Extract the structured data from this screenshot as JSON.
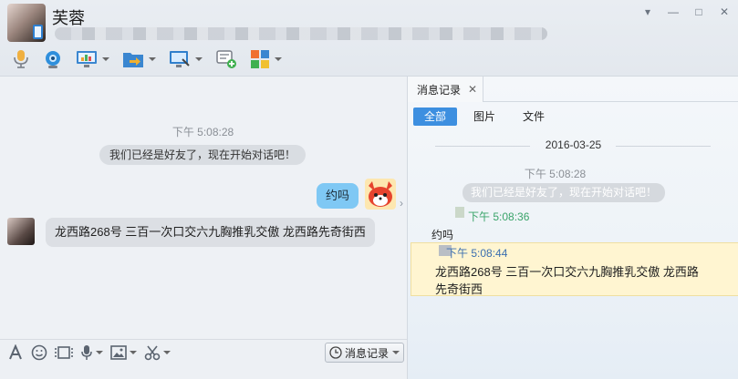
{
  "contact": {
    "name": "芙蓉"
  },
  "window_controls": [
    "▾",
    "—",
    "□",
    "✕"
  ],
  "chat": {
    "timestamp": "下午 5:08:28",
    "system_message": "我们已经是好友了，现在开始对话吧！",
    "my_message": "约吗",
    "peer_message": "龙西路268号 三百一次口交六九胸推乳交傲  龙西路先奇街西"
  },
  "input_bar": {
    "history_button_label": "消息记录"
  },
  "history": {
    "tab_label": "消息记录",
    "filters": [
      "全部",
      "图片",
      "文件"
    ],
    "date": "2016-03-25",
    "entries": {
      "system_time": "下午 5:08:28",
      "system_message": "我们已经是好友了，现在开始对话吧！",
      "my_time": "下午 5:08:36",
      "my_message": "约吗",
      "peer_time": "下午 5:08:44",
      "peer_message": "龙西路268号 三百一次口交六九胸推乳交傲  龙西路先奇街西"
    }
  },
  "colors": {
    "accent": "#3d8fe0",
    "my_bubble": "#7fc8f4",
    "highlight": "#fff5d1"
  }
}
